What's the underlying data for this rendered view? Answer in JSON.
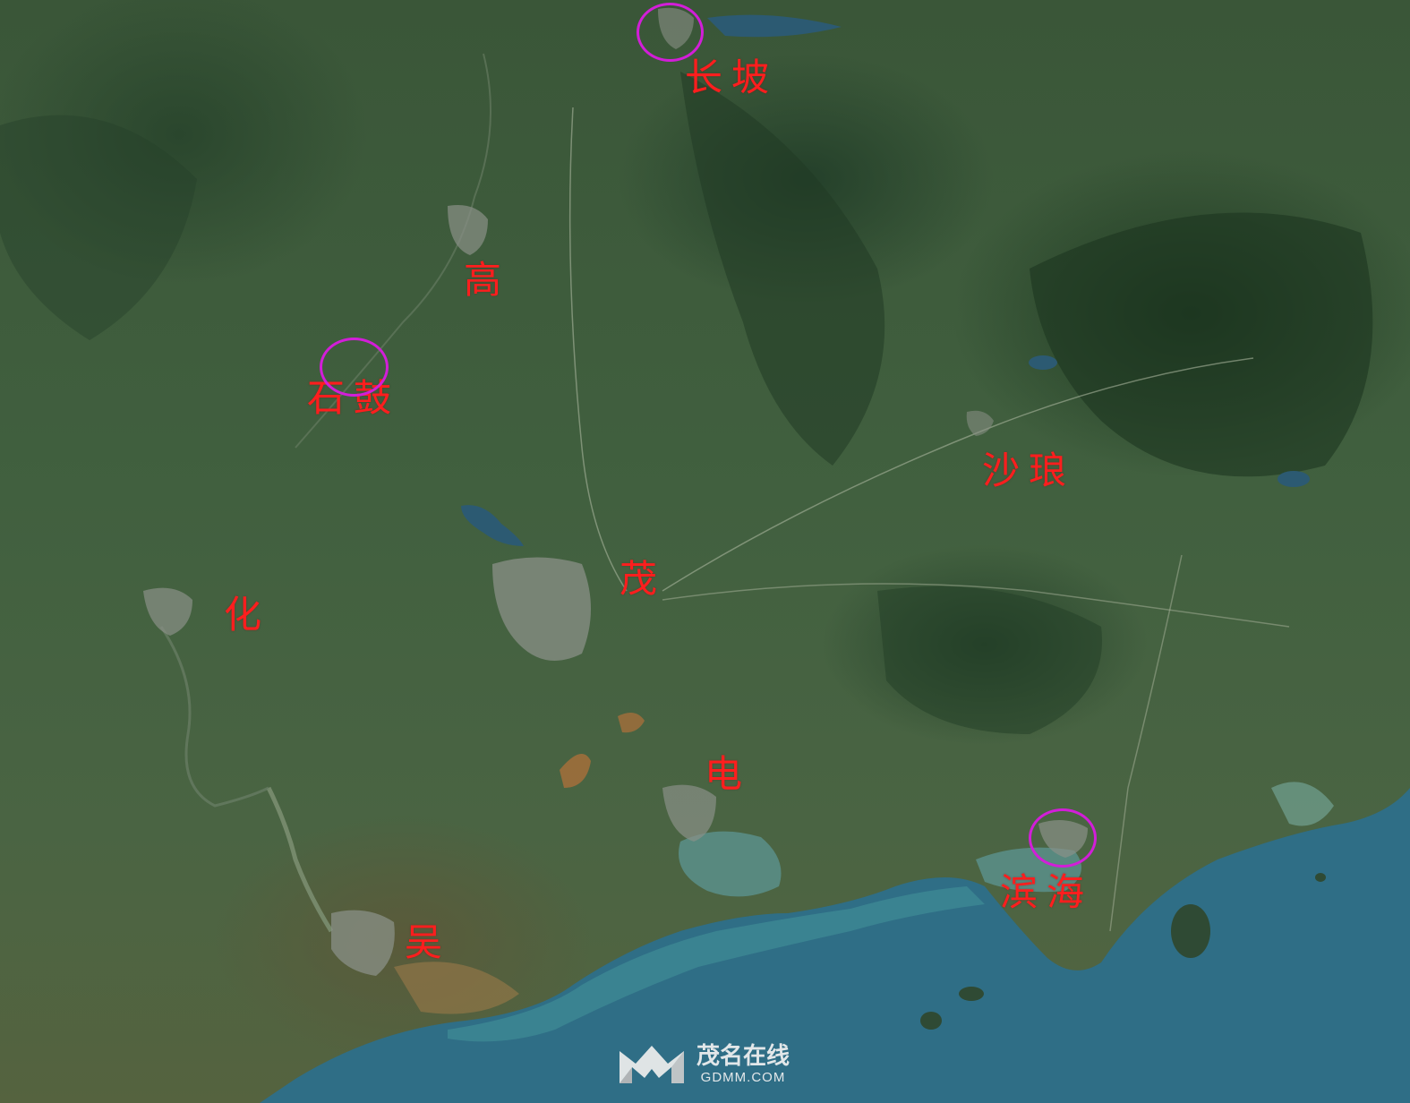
{
  "map": {
    "labels": {
      "changpo": "长坡",
      "gao": "高",
      "shigu": "石鼓",
      "shalang": "沙琅",
      "mao": "茂",
      "hua": "化",
      "dian": "电",
      "wu": "吴",
      "binhai": "滨海"
    },
    "circle_color": "#d21ed8",
    "label_color": "#ff1e1e"
  },
  "watermark": {
    "name": "茂名在线",
    "url": "GDMM.COM"
  }
}
